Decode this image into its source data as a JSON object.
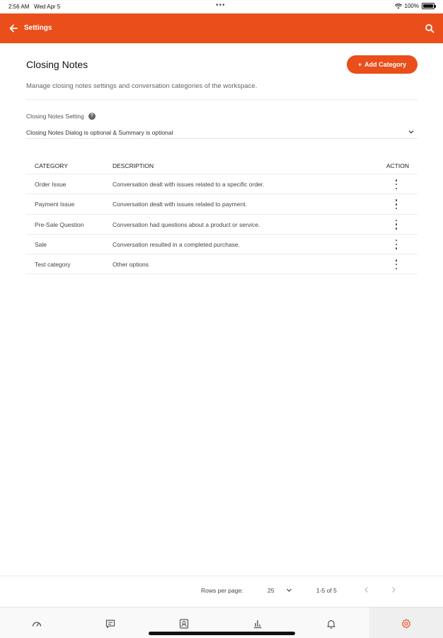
{
  "status_bar": {
    "time": "2:56 AM",
    "date": "Wed Apr 5",
    "battery": "100%",
    "battery_level": 1.0
  },
  "app_bar": {
    "title": "Settings",
    "back_icon": "arrow-left-icon",
    "search_icon": "search-icon",
    "color": "#ea4e1b"
  },
  "page": {
    "title": "Closing Notes",
    "add_button_label": "Add Category",
    "subtitle": "Manage closing notes settings and conversation categories of the workspace."
  },
  "setting": {
    "label": "Closing Notes Setting",
    "value": "Closing Notes Dialog is optional & Summary is optional"
  },
  "table": {
    "headers": {
      "category": "CATEGORY",
      "description": "DESCRIPTION",
      "action": "ACTION"
    },
    "rows": [
      {
        "category": "Order Issue",
        "description": "Conversation dealt with issues related to a specific order."
      },
      {
        "category": "Payment Issue",
        "description": "Conversation dealt with issues related to payment."
      },
      {
        "category": "Pre-Sale Question",
        "description": "Conversation had questions about a product or service."
      },
      {
        "category": "Sale",
        "description": "Conversation resulted in a completed purchase."
      },
      {
        "category": "Test category",
        "description": "Other options"
      }
    ]
  },
  "pagination": {
    "rows_per_page_label": "Rows per page:",
    "rows_per_page": "25",
    "range": "1-5 of 5"
  },
  "bottom_nav": {
    "items": [
      "dashboard-icon",
      "chat-icon",
      "contacts-icon",
      "reports-icon",
      "notifications-icon",
      "settings-icon"
    ],
    "active": "settings-icon",
    "active_color": "#ea4e1b"
  }
}
